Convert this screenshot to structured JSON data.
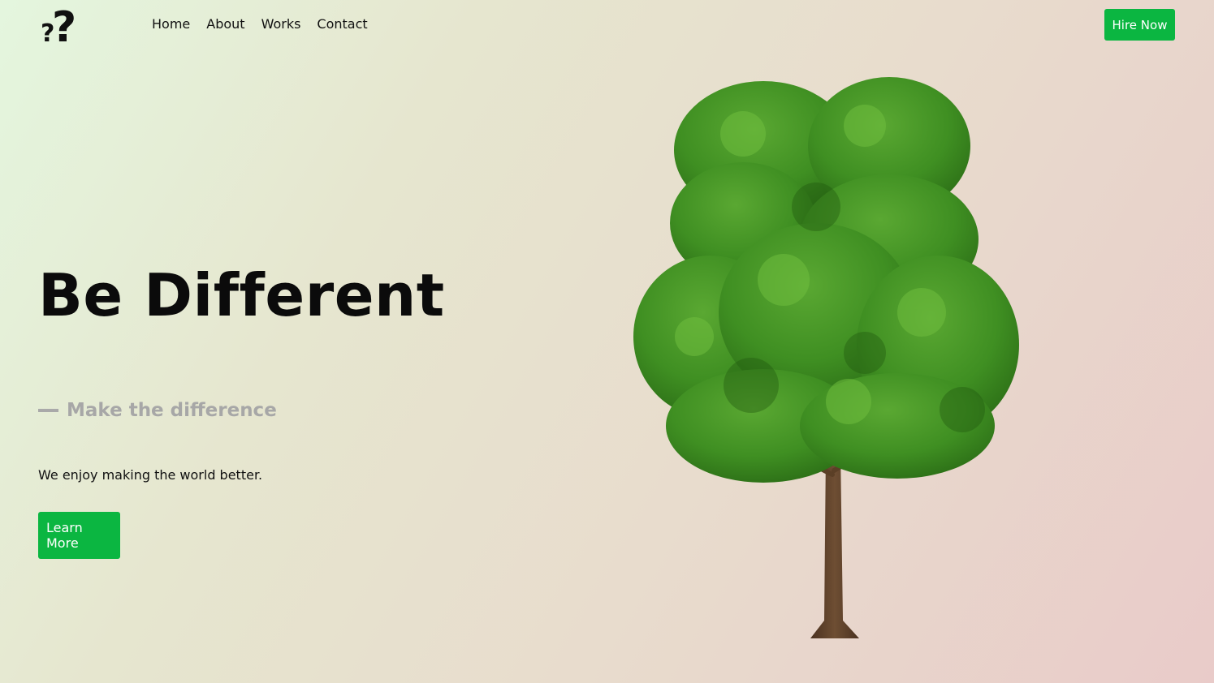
{
  "header": {
    "logo_icon": "question-marks-logo-icon",
    "nav": [
      {
        "label": "Home"
      },
      {
        "label": "About"
      },
      {
        "label": "Works"
      },
      {
        "label": "Contact"
      }
    ],
    "hire_label": "Hire Now"
  },
  "hero": {
    "title": "Be Different",
    "subtitle": "Make the difference",
    "description": "We enjoy making the world better.",
    "cta_label": "Learn More",
    "image": "tree-illustration"
  },
  "colors": {
    "accent": "#0bb641",
    "subtitle": "#a7a7a7",
    "foliage": "#3f8f22",
    "trunk": "#5b3f26"
  }
}
